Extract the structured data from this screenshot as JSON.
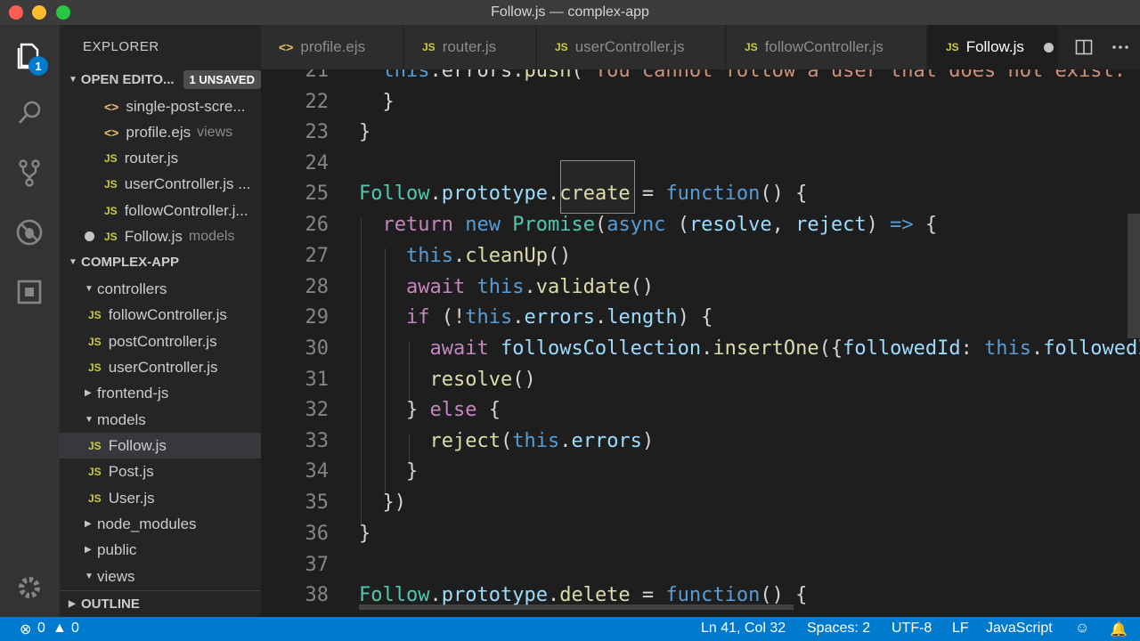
{
  "window": {
    "title": "Follow.js — complex-app"
  },
  "activity_bar": {
    "badge_count": "1",
    "icons": [
      "files-icon",
      "search-icon",
      "source-control-icon",
      "debug-icon",
      "extensions-icon",
      "gear-icon"
    ]
  },
  "sidebar": {
    "header": "EXPLORER",
    "open_editors": {
      "label": "OPEN EDITO...",
      "badge": "1 UNSAVED",
      "items": [
        {
          "name": "single-post-scre...",
          "hint": ""
        },
        {
          "name": "profile.ejs",
          "hint": "views"
        },
        {
          "name": "router.js",
          "hint": ""
        },
        {
          "name": "userController.js ...",
          "hint": ""
        },
        {
          "name": "followController.j...",
          "hint": ""
        },
        {
          "name": "Follow.js",
          "hint": "models"
        }
      ]
    },
    "project": {
      "label": "COMPLEX-APP",
      "items": [
        "controllers",
        "followController.js",
        "postController.js",
        "userController.js",
        "frontend-js",
        "models",
        "Follow.js",
        "Post.js",
        "User.js",
        "node_modules",
        "public",
        "views"
      ]
    },
    "outline": "OUTLINE"
  },
  "tabs": [
    {
      "label": "profile.ejs",
      "icon": "<>"
    },
    {
      "label": "router.js",
      "icon": "JS"
    },
    {
      "label": "userController.js",
      "icon": "JS"
    },
    {
      "label": "followController.js",
      "icon": "JS"
    },
    {
      "label": "Follow.js",
      "icon": "JS"
    }
  ],
  "editor": {
    "line_numbers": [
      "21",
      "22",
      "23",
      "24",
      "25",
      "26",
      "27",
      "28",
      "29",
      "30",
      "31",
      "32",
      "33",
      "34",
      "35",
      "36",
      "37",
      "38"
    ]
  },
  "status": {
    "errors": "0",
    "warnings": "0",
    "position": "Ln 41, Col 32",
    "spaces": "Spaces: 2",
    "encoding": "UTF-8",
    "eol": "LF",
    "language": "JavaScript"
  },
  "colors": {
    "accent": "#007acc",
    "keyword": "#c586c0",
    "storage": "#569cd6",
    "class": "#4ec9b0",
    "function": "#dcdcaa",
    "variable": "#9cdcfe",
    "string": "#ce9178"
  }
}
